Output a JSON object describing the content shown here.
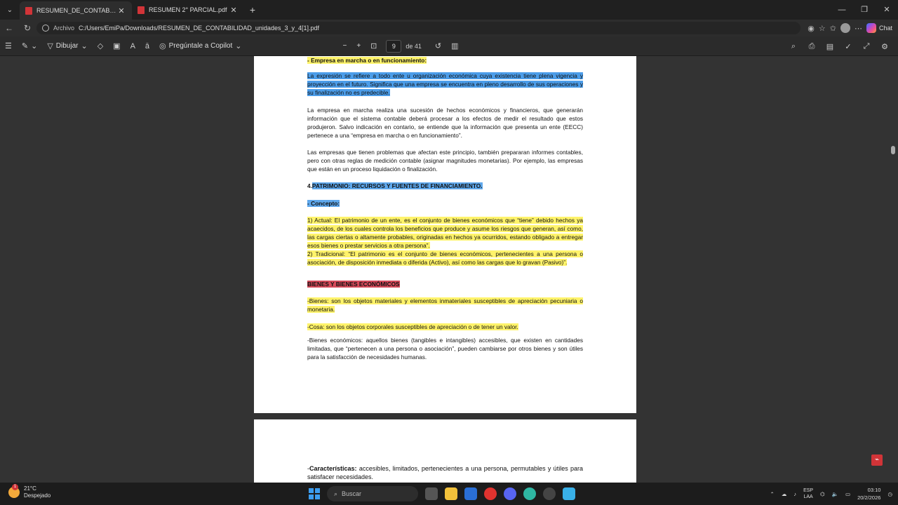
{
  "browser": {
    "tabs": [
      {
        "title": "RESUMEN_DE_CONTABILIDAD_uni",
        "active": true
      },
      {
        "title": "RESUMEN 2° PARCIAL.pdf",
        "active": false
      }
    ],
    "new_tab": "+",
    "window_controls": [
      "—",
      "❐",
      "✕"
    ],
    "address_label": "Archivo",
    "address": "C:/Users/EmiPa/Downloads/RESUMEN_DE_CONTABILIDAD_unidades_3_y_4[1].pdf",
    "chat_label": "Chat"
  },
  "pdf_toolbar": {
    "draw_label": "Dibujar",
    "copilot_label": "Pregúntale a Copilot",
    "zoom_out": "−",
    "zoom_in": "+",
    "page_current": "9",
    "page_total": "de 41"
  },
  "page1": {
    "heading_marcha": "- Empresa en marcha o en funcionamiento:",
    "para_selected": "La expresión se refiere a todo ente u organización económica cuya existencia tiene plena vigencia y proyección en el futuro. Significa que una empresa se encuentra en pleno desarrollo de sus operaciones y su finalización no es predecible.",
    "para_2": "La empresa en marcha realiza una sucesión de hechos económicos y financieros, que generarán información que el sistema contable deberá procesar a los efectos de medir el resultado que estos produjeron. Salvo indicación en contario, se entiende que la información que presenta un ente (EECC) pertenece a una “empresa en marcha o en funcionamiento”.",
    "para_3": "Las empresas que tienen problemas que afectan este principio, también prepararan informes contables, pero con otras reglas de medición contable (asignar magnitudes monetarias). Por ejemplo, las empresas que están en un proceso liquidación o finalización.",
    "heading_patrimonio_num": "4.",
    "heading_patrimonio": "PATRIMONIO: RECURSOS Y FUENTES DE FINANCIAMIENTO.",
    "concepto_dash": "- ",
    "concepto": "Concepto:",
    "def_actual": "1) Actual: El patrimonio de un ente, es el conjunto de bienes económicos que “tiene” debido hechos ya acaecidos, de los cuales controla los beneficios que produce y asume los riesgos que generan, así como, las cargas ciertas o altamente probables, originadas en hechos ya ocurridos, estando obligado a entregar esos bienes o prestar servicios a otra persona”.",
    "def_tradicional": "2) Tradicional: “El patrimonio es el conjunto de bienes económicos, pertenecientes a una persona o asociación, de disposición inmediata o diferida (Activo), así como las cargas que lo gravan (Pasivo)”.",
    "heading_bienes": "BIENES Y BIENES ECONÓMICOS",
    "bienes_def": "-Bienes: son los objetos materiales y elementos inmateriales susceptibles de apreciación pecuniaria o monetaria.",
    "cosa_def": "-Cosa: son los objetos corporales susceptibles de apreciación o de tener un valor.",
    "bienes_econ": "-Bienes económicos: aquellos bienes (tangibles e intangibles) accesibles, que existen en cantidades limitadas, que “pertenecen a una persona o asociación”, pueden cambiarse por otros bienes y son útiles para la satisfacción de necesidades humanas."
  },
  "page2": {
    "caract_dash": "-",
    "caract_label": "Características:",
    "caract_text": " accesibles, limitados, pertenecientes a una persona, permutables y útiles para satisfacer necesidades."
  },
  "taskbar": {
    "temp": "21°C",
    "weather": "Despejado",
    "weather_badge": "1",
    "search_placeholder": "Buscar",
    "lang_1": "ESP",
    "lang_2": "LAA",
    "time": "03:10",
    "date": "20/2/2026"
  },
  "colors": {
    "highlight_yellow": "#fff36a",
    "highlight_blue": "#5fa8ec",
    "highlight_red": "#d64a5a",
    "accent": "#3c9df0"
  }
}
